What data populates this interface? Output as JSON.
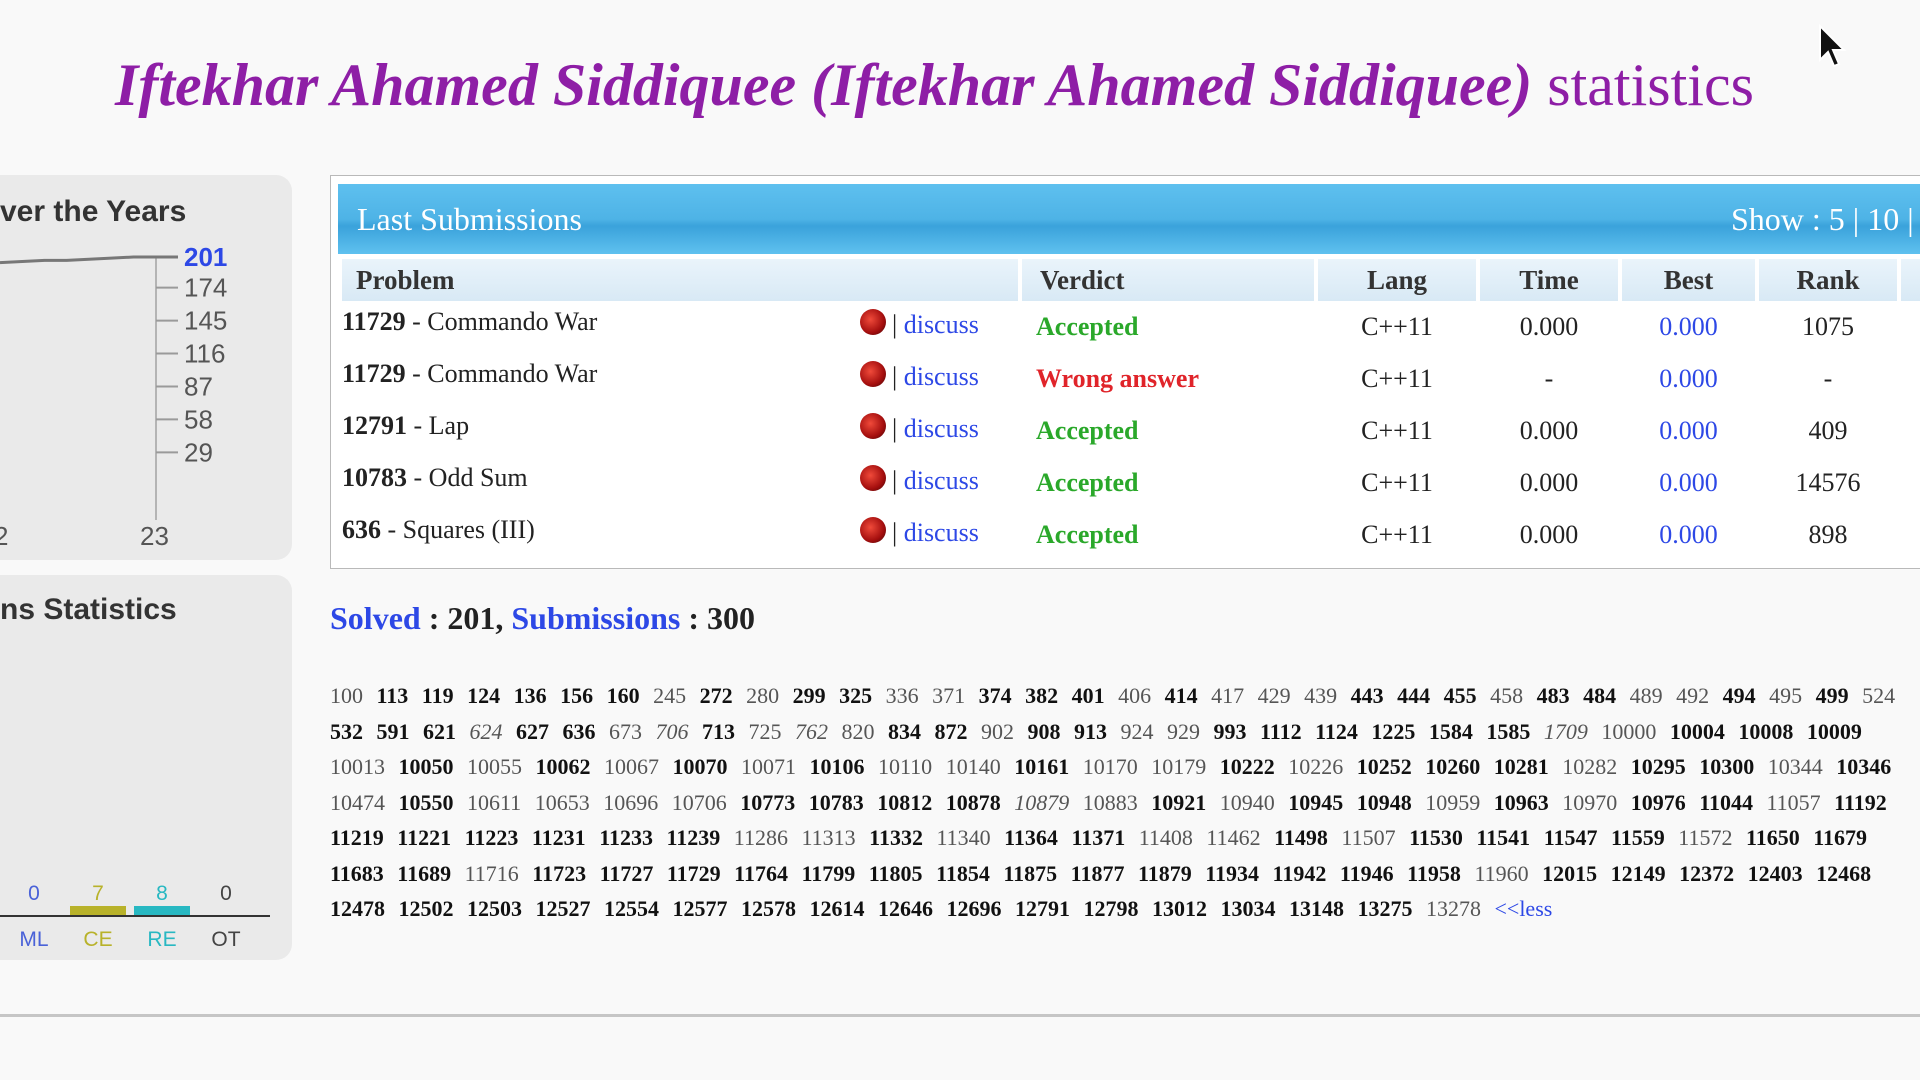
{
  "page": {
    "title_name": "Iftekhar Ahamed Siddiquee (Iftekhar Ahamed Siddiquee)",
    "title_suffix": "statistics"
  },
  "left_panels": {
    "years_title": "ver the Years",
    "stats_title": "ns Statistics"
  },
  "chart_data": [
    {
      "type": "line",
      "title": "ver the Years",
      "y_ticks": [
        201,
        174,
        145,
        116,
        87,
        58,
        29
      ],
      "x_ticks": [
        "2",
        "23"
      ],
      "highlight_tick": 201,
      "series": [
        {
          "values": [
            196,
            197,
            198,
            198,
            199,
            200,
            201,
            201,
            201
          ]
        }
      ]
    },
    {
      "type": "bar",
      "title": "ns Statistics",
      "categories": [
        "ML",
        "CE",
        "RE",
        "OT"
      ],
      "values": [
        0,
        7,
        8,
        0
      ],
      "colors": [
        "#4a62d8",
        "#b8b22a",
        "#28b8c2",
        "#444444"
      ]
    }
  ],
  "submissions": {
    "title": "Last Submissions",
    "show_label": "Show :",
    "show_options": [
      "5",
      "10"
    ],
    "columns": [
      "Problem",
      "Verdict",
      "Lang",
      "Time",
      "Best",
      "Rank"
    ],
    "discuss_label": "discuss",
    "rows": [
      {
        "id": "11729",
        "name": "Commando War",
        "verdict": "Accepted",
        "lang": "C++11",
        "time": "0.000",
        "best": "0.000",
        "rank": "1075"
      },
      {
        "id": "11729",
        "name": "Commando War",
        "verdict": "Wrong answer",
        "lang": "C++11",
        "time": "-",
        "best": "0.000",
        "rank": "-"
      },
      {
        "id": "12791",
        "name": "Lap",
        "verdict": "Accepted",
        "lang": "C++11",
        "time": "0.000",
        "best": "0.000",
        "rank": "409"
      },
      {
        "id": "10783",
        "name": "Odd Sum",
        "verdict": "Accepted",
        "lang": "C++11",
        "time": "0.000",
        "best": "0.000",
        "rank": "14576"
      },
      {
        "id": "636",
        "name": "Squares (III)",
        "verdict": "Accepted",
        "lang": "C++11",
        "time": "0.000",
        "best": "0.000",
        "rank": "898"
      }
    ]
  },
  "summary": {
    "solved_label": "Solved",
    "solved_value": "201",
    "submissions_label": "Submissions",
    "submissions_value": "300"
  },
  "problems_less_label": "<<less",
  "problems": [
    [
      "100",
      "n"
    ],
    [
      "113",
      "b"
    ],
    [
      "119",
      "b"
    ],
    [
      "124",
      "b"
    ],
    [
      "136",
      "b"
    ],
    [
      "156",
      "b"
    ],
    [
      "160",
      "b"
    ],
    [
      "245",
      "n"
    ],
    [
      "272",
      "b"
    ],
    [
      "280",
      "n"
    ],
    [
      "299",
      "b"
    ],
    [
      "325",
      "b"
    ],
    [
      "336",
      "n"
    ],
    [
      "371",
      "n"
    ],
    [
      "374",
      "b"
    ],
    [
      "382",
      "b"
    ],
    [
      "401",
      "b"
    ],
    [
      "406",
      "n"
    ],
    [
      "414",
      "b"
    ],
    [
      "417",
      "n"
    ],
    [
      "429",
      "n"
    ],
    [
      "439",
      "n"
    ],
    [
      "443",
      "b"
    ],
    [
      "444",
      "b"
    ],
    [
      "455",
      "b"
    ],
    [
      "458",
      "n"
    ],
    [
      "483",
      "b"
    ],
    [
      "484",
      "b"
    ],
    [
      "489",
      "n"
    ],
    [
      "492",
      "n"
    ],
    [
      "494",
      "b"
    ],
    [
      "495",
      "n"
    ],
    [
      "499",
      "b"
    ],
    [
      "524",
      "n"
    ],
    [
      "532",
      "b"
    ],
    [
      "591",
      "b"
    ],
    [
      "621",
      "b"
    ],
    [
      "624",
      "i"
    ],
    [
      "627",
      "b"
    ],
    [
      "636",
      "b"
    ],
    [
      "673",
      "n"
    ],
    [
      "706",
      "i"
    ],
    [
      "713",
      "b"
    ],
    [
      "725",
      "n"
    ],
    [
      "762",
      "i"
    ],
    [
      "820",
      "n"
    ],
    [
      "834",
      "b"
    ],
    [
      "872",
      "b"
    ],
    [
      "902",
      "n"
    ],
    [
      "908",
      "b"
    ],
    [
      "913",
      "b"
    ],
    [
      "924",
      "n"
    ],
    [
      "929",
      "n"
    ],
    [
      "993",
      "b"
    ],
    [
      "1112",
      "b"
    ],
    [
      "1124",
      "b"
    ],
    [
      "1225",
      "b"
    ],
    [
      "1584",
      "b"
    ],
    [
      "1585",
      "b"
    ],
    [
      "1709",
      "i"
    ],
    [
      "10000",
      "n"
    ],
    [
      "10004",
      "b"
    ],
    [
      "10008",
      "b"
    ],
    [
      "10009",
      "b"
    ],
    [
      "10013",
      "n"
    ],
    [
      "10050",
      "b"
    ],
    [
      "10055",
      "n"
    ],
    [
      "10062",
      "b"
    ],
    [
      "10067",
      "n"
    ],
    [
      "10070",
      "b"
    ],
    [
      "10071",
      "n"
    ],
    [
      "10106",
      "b"
    ],
    [
      "10110",
      "n"
    ],
    [
      "10140",
      "n"
    ],
    [
      "10161",
      "b"
    ],
    [
      "10170",
      "n"
    ],
    [
      "10179",
      "n"
    ],
    [
      "10222",
      "b"
    ],
    [
      "10226",
      "n"
    ],
    [
      "10252",
      "b"
    ],
    [
      "10260",
      "b"
    ],
    [
      "10281",
      "b"
    ],
    [
      "10282",
      "n"
    ],
    [
      "10295",
      "b"
    ],
    [
      "10300",
      "b"
    ],
    [
      "10344",
      "n"
    ],
    [
      "10346",
      "b"
    ],
    [
      "10474",
      "n"
    ],
    [
      "10550",
      "b"
    ],
    [
      "10611",
      "n"
    ],
    [
      "10653",
      "n"
    ],
    [
      "10696",
      "n"
    ],
    [
      "10706",
      "n"
    ],
    [
      "10773",
      "b"
    ],
    [
      "10783",
      "b"
    ],
    [
      "10812",
      "b"
    ],
    [
      "10878",
      "b"
    ],
    [
      "10879",
      "i"
    ],
    [
      "10883",
      "n"
    ],
    [
      "10921",
      "b"
    ],
    [
      "10940",
      "n"
    ],
    [
      "10945",
      "b"
    ],
    [
      "10948",
      "b"
    ],
    [
      "10959",
      "n"
    ],
    [
      "10963",
      "b"
    ],
    [
      "10970",
      "n"
    ],
    [
      "10976",
      "b"
    ],
    [
      "11044",
      "b"
    ],
    [
      "11057",
      "n"
    ],
    [
      "11192",
      "b"
    ],
    [
      "11219",
      "b"
    ],
    [
      "11221",
      "b"
    ],
    [
      "11223",
      "b"
    ],
    [
      "11231",
      "b"
    ],
    [
      "11233",
      "b"
    ],
    [
      "11239",
      "b"
    ],
    [
      "11286",
      "n"
    ],
    [
      "11313",
      "n"
    ],
    [
      "11332",
      "b"
    ],
    [
      "11340",
      "n"
    ],
    [
      "11364",
      "b"
    ],
    [
      "11371",
      "b"
    ],
    [
      "11408",
      "n"
    ],
    [
      "11462",
      "n"
    ],
    [
      "11498",
      "b"
    ],
    [
      "11507",
      "n"
    ],
    [
      "11530",
      "b"
    ],
    [
      "11541",
      "b"
    ],
    [
      "11547",
      "b"
    ],
    [
      "11559",
      "b"
    ],
    [
      "11572",
      "n"
    ],
    [
      "11650",
      "b"
    ],
    [
      "11679",
      "b"
    ],
    [
      "11683",
      "b"
    ],
    [
      "11689",
      "b"
    ],
    [
      "11716",
      "n"
    ],
    [
      "11723",
      "b"
    ],
    [
      "11727",
      "b"
    ],
    [
      "11729",
      "b"
    ],
    [
      "11764",
      "b"
    ],
    [
      "11799",
      "b"
    ],
    [
      "11805",
      "b"
    ],
    [
      "11854",
      "b"
    ],
    [
      "11875",
      "b"
    ],
    [
      "11877",
      "b"
    ],
    [
      "11879",
      "b"
    ],
    [
      "11934",
      "b"
    ],
    [
      "11942",
      "b"
    ],
    [
      "11946",
      "b"
    ],
    [
      "11958",
      "b"
    ],
    [
      "11960",
      "n"
    ],
    [
      "12015",
      "b"
    ],
    [
      "12149",
      "b"
    ],
    [
      "12372",
      "b"
    ],
    [
      "12403",
      "b"
    ],
    [
      "12468",
      "b"
    ],
    [
      "12478",
      "b"
    ],
    [
      "12502",
      "b"
    ],
    [
      "12503",
      "b"
    ],
    [
      "12527",
      "b"
    ],
    [
      "12554",
      "b"
    ],
    [
      "12577",
      "b"
    ],
    [
      "12578",
      "b"
    ],
    [
      "12614",
      "b"
    ],
    [
      "12646",
      "b"
    ],
    [
      "12696",
      "b"
    ],
    [
      "12791",
      "b"
    ],
    [
      "12798",
      "b"
    ],
    [
      "13012",
      "b"
    ],
    [
      "13034",
      "b"
    ],
    [
      "13148",
      "b"
    ],
    [
      "13275",
      "b"
    ],
    [
      "13278",
      "n"
    ]
  ]
}
